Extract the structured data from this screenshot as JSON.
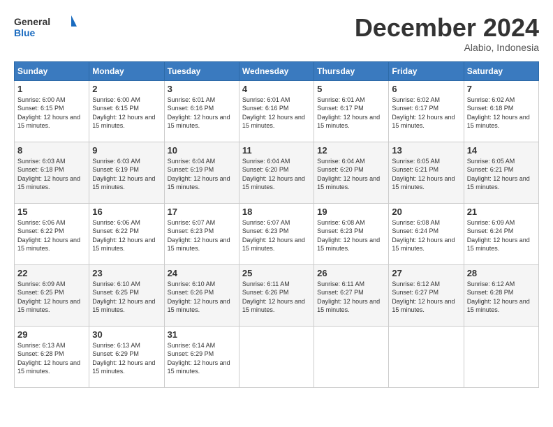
{
  "header": {
    "logo": {
      "general": "General",
      "blue": "Blue"
    },
    "title": "December 2024",
    "subtitle": "Alabio, Indonesia"
  },
  "calendar": {
    "days_of_week": [
      "Sunday",
      "Monday",
      "Tuesday",
      "Wednesday",
      "Thursday",
      "Friday",
      "Saturday"
    ],
    "weeks": [
      [
        null,
        null,
        null,
        null,
        null,
        null,
        null
      ]
    ],
    "cells": [
      {
        "day": null,
        "detail": ""
      },
      {
        "day": null,
        "detail": ""
      },
      {
        "day": null,
        "detail": ""
      },
      {
        "day": null,
        "detail": ""
      },
      {
        "day": null,
        "detail": ""
      },
      {
        "day": null,
        "detail": ""
      },
      {
        "day": null,
        "detail": ""
      }
    ],
    "rows": [
      [
        {
          "day": "1",
          "sunrise": "6:00 AM",
          "sunset": "6:15 PM",
          "daylight": "12 hours and 15 minutes."
        },
        {
          "day": "2",
          "sunrise": "6:00 AM",
          "sunset": "6:15 PM",
          "daylight": "12 hours and 15 minutes."
        },
        {
          "day": "3",
          "sunrise": "6:01 AM",
          "sunset": "6:16 PM",
          "daylight": "12 hours and 15 minutes."
        },
        {
          "day": "4",
          "sunrise": "6:01 AM",
          "sunset": "6:16 PM",
          "daylight": "12 hours and 15 minutes."
        },
        {
          "day": "5",
          "sunrise": "6:01 AM",
          "sunset": "6:17 PM",
          "daylight": "12 hours and 15 minutes."
        },
        {
          "day": "6",
          "sunrise": "6:02 AM",
          "sunset": "6:17 PM",
          "daylight": "12 hours and 15 minutes."
        },
        {
          "day": "7",
          "sunrise": "6:02 AM",
          "sunset": "6:18 PM",
          "daylight": "12 hours and 15 minutes."
        }
      ],
      [
        {
          "day": "8",
          "sunrise": "6:03 AM",
          "sunset": "6:18 PM",
          "daylight": "12 hours and 15 minutes."
        },
        {
          "day": "9",
          "sunrise": "6:03 AM",
          "sunset": "6:19 PM",
          "daylight": "12 hours and 15 minutes."
        },
        {
          "day": "10",
          "sunrise": "6:04 AM",
          "sunset": "6:19 PM",
          "daylight": "12 hours and 15 minutes."
        },
        {
          "day": "11",
          "sunrise": "6:04 AM",
          "sunset": "6:20 PM",
          "daylight": "12 hours and 15 minutes."
        },
        {
          "day": "12",
          "sunrise": "6:04 AM",
          "sunset": "6:20 PM",
          "daylight": "12 hours and 15 minutes."
        },
        {
          "day": "13",
          "sunrise": "6:05 AM",
          "sunset": "6:21 PM",
          "daylight": "12 hours and 15 minutes."
        },
        {
          "day": "14",
          "sunrise": "6:05 AM",
          "sunset": "6:21 PM",
          "daylight": "12 hours and 15 minutes."
        }
      ],
      [
        {
          "day": "15",
          "sunrise": "6:06 AM",
          "sunset": "6:22 PM",
          "daylight": "12 hours and 15 minutes."
        },
        {
          "day": "16",
          "sunrise": "6:06 AM",
          "sunset": "6:22 PM",
          "daylight": "12 hours and 15 minutes."
        },
        {
          "day": "17",
          "sunrise": "6:07 AM",
          "sunset": "6:23 PM",
          "daylight": "12 hours and 15 minutes."
        },
        {
          "day": "18",
          "sunrise": "6:07 AM",
          "sunset": "6:23 PM",
          "daylight": "12 hours and 15 minutes."
        },
        {
          "day": "19",
          "sunrise": "6:08 AM",
          "sunset": "6:23 PM",
          "daylight": "12 hours and 15 minutes."
        },
        {
          "day": "20",
          "sunrise": "6:08 AM",
          "sunset": "6:24 PM",
          "daylight": "12 hours and 15 minutes."
        },
        {
          "day": "21",
          "sunrise": "6:09 AM",
          "sunset": "6:24 PM",
          "daylight": "12 hours and 15 minutes."
        }
      ],
      [
        {
          "day": "22",
          "sunrise": "6:09 AM",
          "sunset": "6:25 PM",
          "daylight": "12 hours and 15 minutes."
        },
        {
          "day": "23",
          "sunrise": "6:10 AM",
          "sunset": "6:25 PM",
          "daylight": "12 hours and 15 minutes."
        },
        {
          "day": "24",
          "sunrise": "6:10 AM",
          "sunset": "6:26 PM",
          "daylight": "12 hours and 15 minutes."
        },
        {
          "day": "25",
          "sunrise": "6:11 AM",
          "sunset": "6:26 PM",
          "daylight": "12 hours and 15 minutes."
        },
        {
          "day": "26",
          "sunrise": "6:11 AM",
          "sunset": "6:27 PM",
          "daylight": "12 hours and 15 minutes."
        },
        {
          "day": "27",
          "sunrise": "6:12 AM",
          "sunset": "6:27 PM",
          "daylight": "12 hours and 15 minutes."
        },
        {
          "day": "28",
          "sunrise": "6:12 AM",
          "sunset": "6:28 PM",
          "daylight": "12 hours and 15 minutes."
        }
      ],
      [
        {
          "day": "29",
          "sunrise": "6:13 AM",
          "sunset": "6:28 PM",
          "daylight": "12 hours and 15 minutes."
        },
        {
          "day": "30",
          "sunrise": "6:13 AM",
          "sunset": "6:29 PM",
          "daylight": "12 hours and 15 minutes."
        },
        {
          "day": "31",
          "sunrise": "6:14 AM",
          "sunset": "6:29 PM",
          "daylight": "12 hours and 15 minutes."
        },
        null,
        null,
        null,
        null
      ]
    ]
  }
}
